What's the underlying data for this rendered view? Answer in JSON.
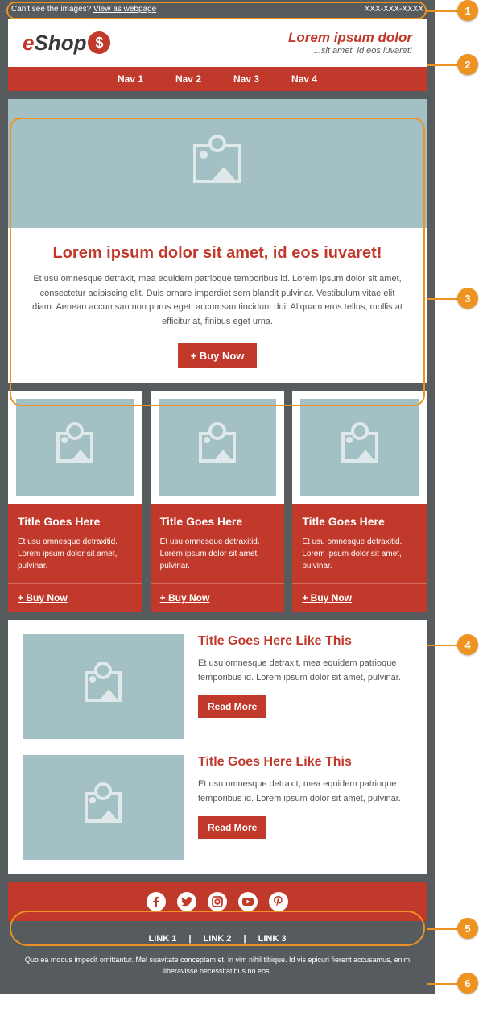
{
  "preheader": {
    "question": "Can't see the images?",
    "link": "View as webpage",
    "phone": "XXX-XXX-XXXX"
  },
  "logo": {
    "part1": "e",
    "part2": "Shop",
    "symbol": "$"
  },
  "tagline": {
    "title": "Lorem ipsum dolor",
    "sub": "...sit amet, id eos iuvaret!"
  },
  "nav": [
    "Nav 1",
    "Nav 2",
    "Nav 3",
    "Nav 4"
  ],
  "hero": {
    "title": "Lorem ipsum dolor sit amet, id eos iuvaret!",
    "body": "Et usu omnesque detraxit, mea equidem patrioque temporibus id. Lorem ipsum dolor sit amet, consectetur adipiscing elit. Duis ornare imperdiet sem blandit pulvinar. Vestibulum vitae elit diam. Aenean accumsan non purus eget, accumsan tincidunt dui. Aliquam eros tellus, mollis at efficitur at, finibus eget urna.",
    "cta": "+ Buy Now"
  },
  "cards": [
    {
      "title": "Title Goes Here",
      "text": "Et usu omnesque detraxitid. Lorem ipsum dolor sit amet, pulvinar.",
      "cta": "+ Buy Now"
    },
    {
      "title": "Title Goes Here",
      "text": "Et usu omnesque detraxitid. Lorem ipsum dolor sit amet, pulvinar.",
      "cta": "+ Buy Now"
    },
    {
      "title": "Title Goes Here",
      "text": "Et usu omnesque detraxitid. Lorem ipsum dolor sit amet, pulvinar.",
      "cta": "+ Buy Now"
    }
  ],
  "articles": [
    {
      "title": "Title Goes Here Like This",
      "text": "Et usu omnesque detraxit, mea equidem patrioque temporibus id. Lorem ipsum dolor sit amet, pulvinar.",
      "cta": "Read More"
    },
    {
      "title": "Title Goes Here Like This",
      "text": "Et usu omnesque detraxit, mea equidem patrioque temporibus id. Lorem ipsum dolor sit amet, pulvinar.",
      "cta": "Read More"
    }
  ],
  "social": [
    "f",
    "t",
    "ig",
    "yt",
    "p"
  ],
  "footer": {
    "links": [
      "LINK 1",
      "LINK 2",
      "LINK 3"
    ],
    "text": "Quo ea modus impedit omittantur. Mel suavitate conceptam et, in vim nihil tibique. Id vis epicuri fierent accusamus, enim liberavisse necessitatibus no eos."
  },
  "annotations": [
    "1",
    "2",
    "3",
    "4",
    "5",
    "6"
  ]
}
